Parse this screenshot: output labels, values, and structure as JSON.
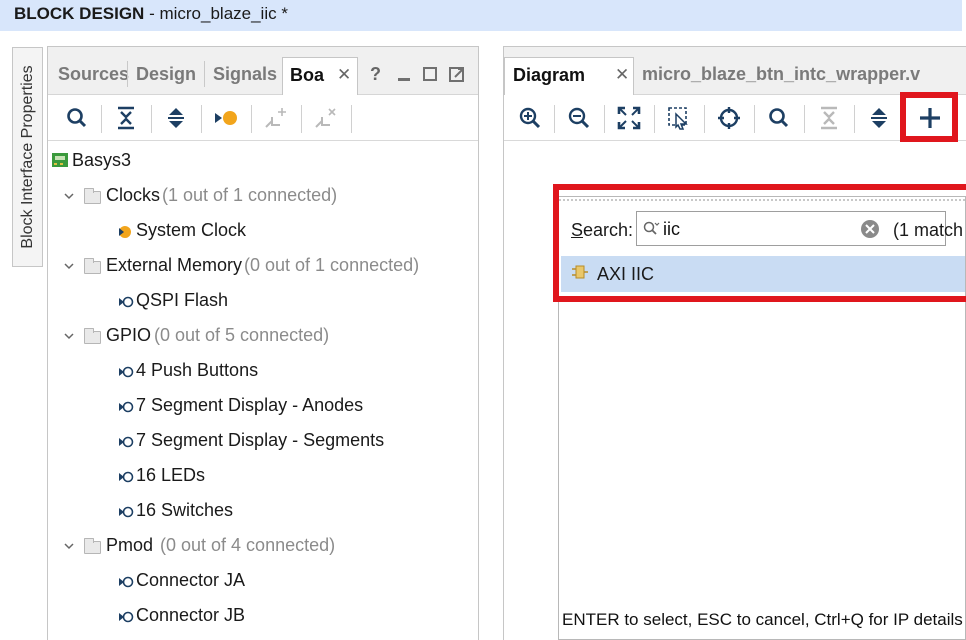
{
  "title": {
    "main": "BLOCK DESIGN",
    "sub": " - micro_blaze_iic *"
  },
  "side_tab": "Block Interface Properties",
  "left_panel": {
    "tabs": [
      "Sources",
      "Design",
      "Signals",
      "Boa"
    ],
    "window_buttons": [
      "?",
      "minimize",
      "restore",
      "float"
    ],
    "toolbar": [
      "search-icon",
      "collapse-all-icon",
      "expand-all-icon",
      "auto-connect-icon",
      "connect-icon",
      "disconnect-icon"
    ],
    "tree": {
      "root": "Basys3",
      "clocks": {
        "label": "Clocks",
        "status": "(1 out of 1 connected)",
        "items": [
          "System Clock"
        ]
      },
      "external_memory": {
        "label": "External Memory",
        "status": "(0 out of 1 connected)",
        "items": [
          "QSPI Flash"
        ]
      },
      "gpio": {
        "label": "GPIO",
        "status": "(0 out of 5 connected)",
        "items": [
          "4 Push Buttons",
          "7 Segment Display - Anodes",
          "7 Segment Display - Segments",
          "16 LEDs",
          "16 Switches"
        ]
      },
      "pmod": {
        "label": "Pmod",
        "status": "(0 out of 4 connected)",
        "items": [
          "Connector JA",
          "Connector JB"
        ]
      }
    }
  },
  "right_panel": {
    "tabs": [
      "Diagram",
      "micro_blaze_btn_intc_wrapper.v"
    ],
    "toolbar": [
      "zoom-in-icon",
      "zoom-out-icon",
      "fit-view-icon",
      "zoom-area-icon",
      "center-icon",
      "search-icon",
      "collapse-icon",
      "expand-icon",
      "add-ip-icon"
    ]
  },
  "ip_search": {
    "label": "Search:",
    "value": "iic",
    "match_text": "(1 match",
    "results": [
      "AXI IIC"
    ],
    "footer": "ENTER to select, ESC to cancel, Ctrl+Q for IP details"
  },
  "colors": {
    "title_bar": "#d8e6fb",
    "selection": "#c9dcf3",
    "highlight": "#e0161d",
    "connected_dot": "#f2a51c"
  }
}
